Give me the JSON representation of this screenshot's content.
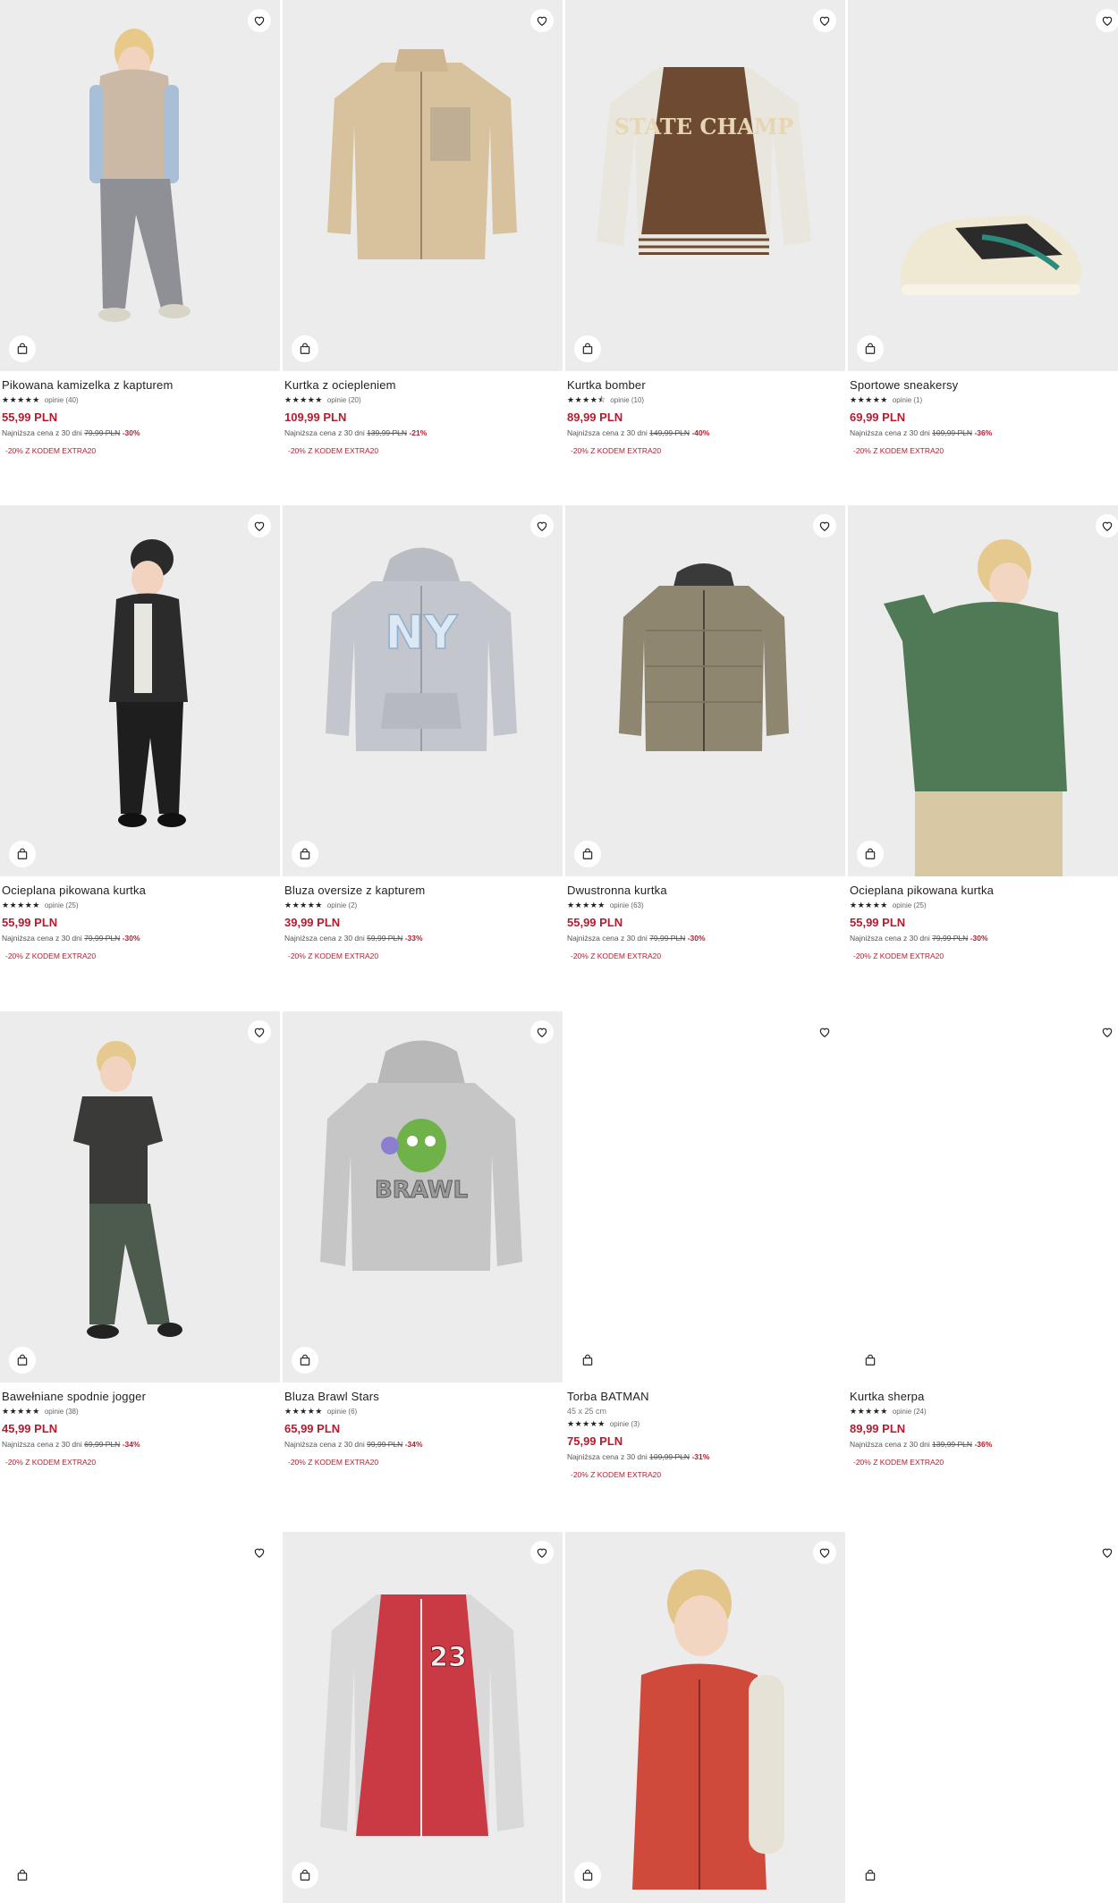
{
  "labels": {
    "lowest_price": "Najniższa cena z 30 dni",
    "promo_code": "-20% Z KODEM EXTRA20"
  },
  "icons": {
    "favorite": "heart-icon",
    "add_to_cart": "shopping-bag-icon"
  },
  "colors": {
    "price": "#b51c2f",
    "image_bg": "#ececec"
  },
  "products": [
    {
      "name": "Pikowana kamizelka z kapturem",
      "stars": "★★★★★",
      "rating": 5,
      "reviews": "opinie (40)",
      "price": "55,99 PLN",
      "old_price": "79,99 PLN",
      "discount": "-30%"
    },
    {
      "name": "Kurtka z ociepleniem",
      "stars": "★★★★★",
      "rating": 5,
      "reviews": "opinie (20)",
      "price": "109,99 PLN",
      "old_price": "139,99 PLN",
      "discount": "-21%"
    },
    {
      "name": "Kurtka bomber",
      "stars": "★★★★⯪",
      "rating": 4.5,
      "reviews": "opinie (10)",
      "price": "89,99 PLN",
      "old_price": "149,99 PLN",
      "discount": "-40%"
    },
    {
      "name": "Sportowe sneakersy",
      "stars": "★★★★★",
      "rating": 5,
      "reviews": "opinie (1)",
      "price": "69,99 PLN",
      "old_price": "109,99 PLN",
      "discount": "-36%"
    },
    {
      "name": "Ocieplana pikowana kurtka",
      "stars": "★★★★★",
      "rating": 5,
      "reviews": "opinie (25)",
      "price": "55,99 PLN",
      "old_price": "79,99 PLN",
      "discount": "-30%"
    },
    {
      "name": "Bluza oversize z kapturem",
      "stars": "★★★★★",
      "rating": 5,
      "reviews": "opinie (2)",
      "price": "39,99 PLN",
      "old_price": "59,99 PLN",
      "discount": "-33%"
    },
    {
      "name": "Dwustronna kurtka",
      "stars": "★★★★★",
      "rating": 5,
      "reviews": "opinie (63)",
      "price": "55,99 PLN",
      "old_price": "79,99 PLN",
      "discount": "-30%"
    },
    {
      "name": "Ocieplana pikowana kurtka",
      "stars": "★★★★★",
      "rating": 5,
      "reviews": "opinie (25)",
      "price": "55,99 PLN",
      "old_price": "79,99 PLN",
      "discount": "-30%"
    },
    {
      "name": "Bawełniane spodnie jogger",
      "stars": "★★★★★",
      "rating": 5,
      "reviews": "opinie (38)",
      "price": "45,99 PLN",
      "old_price": "69,99 PLN",
      "discount": "-34%"
    },
    {
      "name": "Bluza Brawl Stars",
      "stars": "★★★★★",
      "rating": 5,
      "reviews": "opinie (6)",
      "price": "65,99 PLN",
      "old_price": "99,99 PLN",
      "discount": "-34%"
    },
    {
      "name": "Torba BATMAN",
      "dimensions": "45 x 25 cm",
      "stars": "★★★★★",
      "rating": 5,
      "reviews": "opinie (3)",
      "price": "75,99 PLN",
      "old_price": "109,99 PLN",
      "discount": "-31%"
    },
    {
      "name": "Kurtka sherpa",
      "stars": "★★★★★",
      "rating": 5,
      "reviews": "opinie (24)",
      "price": "89,99 PLN",
      "old_price": "139,99 PLN",
      "discount": "-36%"
    },
    {},
    {},
    {},
    {}
  ],
  "image_text": {
    "bomber": "STATE CHAMP",
    "ny": "NY",
    "brawl": "BRAWL",
    "varsity": "23"
  }
}
